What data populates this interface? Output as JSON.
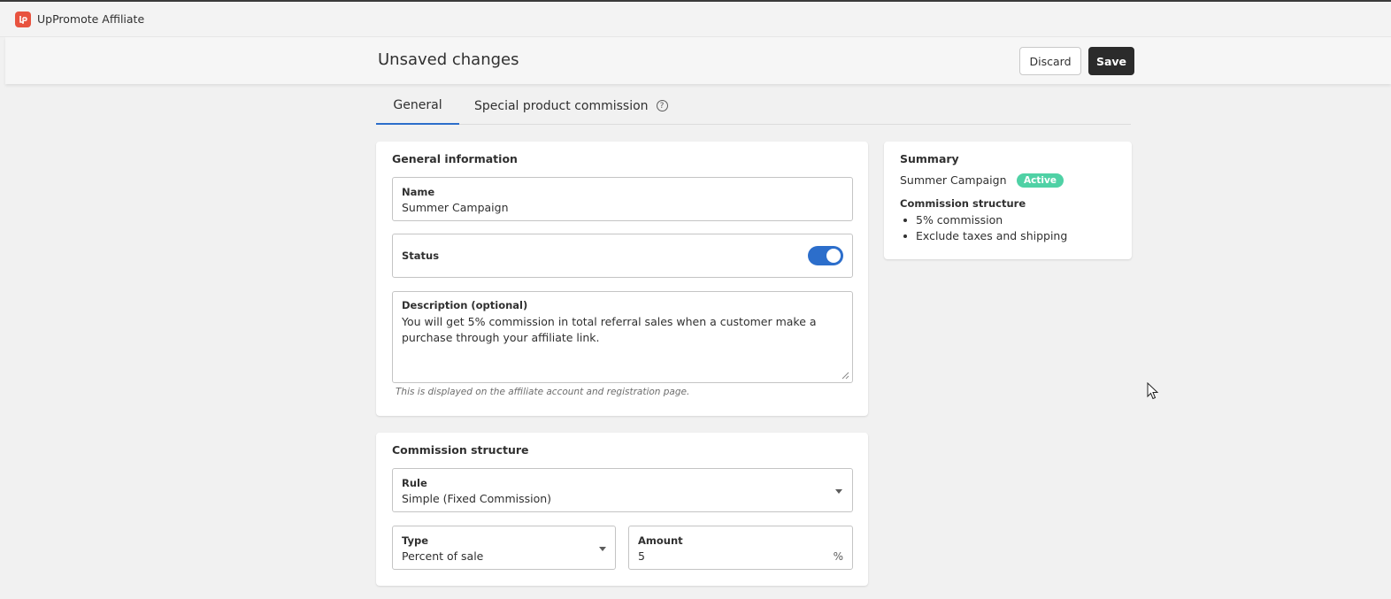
{
  "app": {
    "name": "UpPromote Affiliate",
    "logo_icon": "uppromote-logo-icon",
    "brand_color": "#e8533f"
  },
  "savebar": {
    "title": "Unsaved changes",
    "discard_label": "Discard",
    "save_label": "Save"
  },
  "tabs": [
    {
      "label": "General",
      "selected": true
    },
    {
      "label": "Special product commission",
      "selected": false,
      "icon": "help-icon"
    }
  ],
  "general": {
    "title": "General information",
    "name": {
      "label": "Name",
      "value": "Summer Campaign"
    },
    "status": {
      "label": "Status",
      "enabled": true
    },
    "description": {
      "label": "Description (optional)",
      "value": "You will get 5% commission in total referral sales when a customer make a purchase through your affiliate link.",
      "help": "This is displayed on the affiliate account and registration page."
    }
  },
  "commission": {
    "title": "Commission structure",
    "rule": {
      "label": "Rule",
      "value": "Simple (Fixed Commission)"
    },
    "type": {
      "label": "Type",
      "value": "Percent of sale"
    },
    "amount": {
      "label": "Amount",
      "value": "5",
      "suffix": "%"
    }
  },
  "summary": {
    "title": "Summary",
    "campaign_name": "Summer Campaign",
    "status_badge": "Active",
    "badge_color": "#4fd1a5",
    "structure_title": "Commission structure",
    "items": [
      "5% commission",
      "Exclude taxes and shipping"
    ]
  },
  "colors": {
    "accent": "#2c6ecb",
    "save_button": "#2b2b2b"
  }
}
